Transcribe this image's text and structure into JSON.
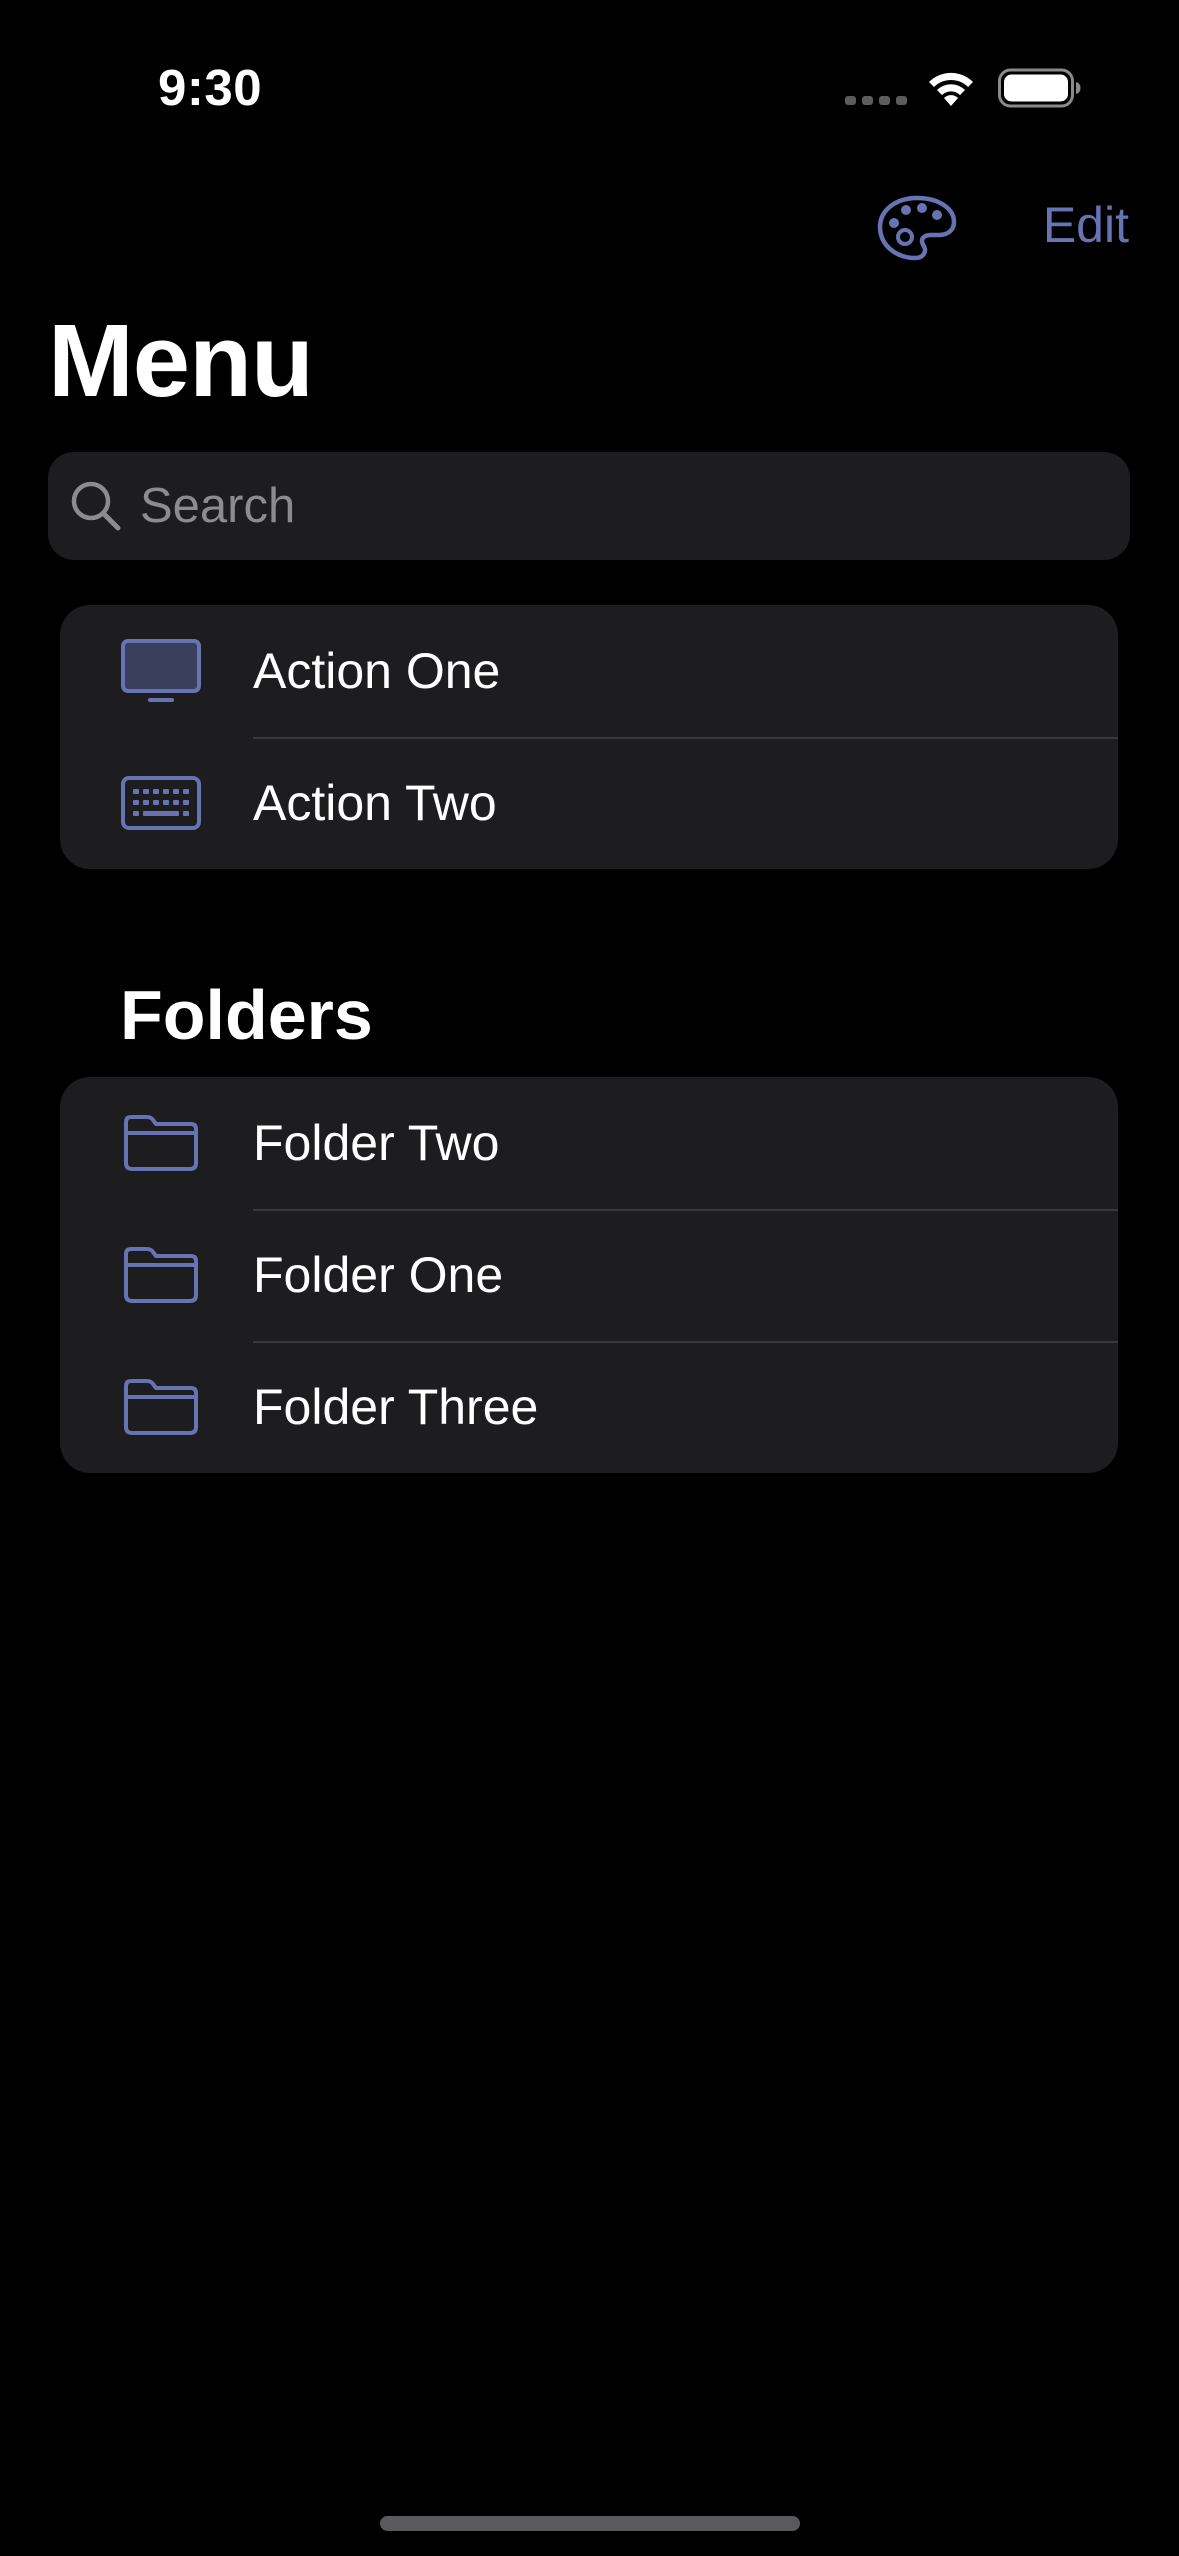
{
  "status_bar": {
    "time": "9:30"
  },
  "nav": {
    "palette_icon": "paintpalette-icon",
    "edit_label": "Edit"
  },
  "title": "Menu",
  "search": {
    "placeholder": "Search",
    "value": ""
  },
  "actions": [
    {
      "label": "Action One",
      "icon": "display-icon"
    },
    {
      "label": "Action Two",
      "icon": "keyboard-icon"
    }
  ],
  "folders_section": {
    "header": "Folders",
    "items": [
      {
        "label": "Folder Two",
        "icon": "folder-icon"
      },
      {
        "label": "Folder One",
        "icon": "folder-icon"
      },
      {
        "label": "Folder Three",
        "icon": "folder-icon"
      }
    ]
  },
  "colors": {
    "accent": "#6773b3",
    "background": "#000000",
    "cell_background": "#1d1d1f",
    "separator": "#38383a",
    "placeholder": "#8b8b90"
  }
}
